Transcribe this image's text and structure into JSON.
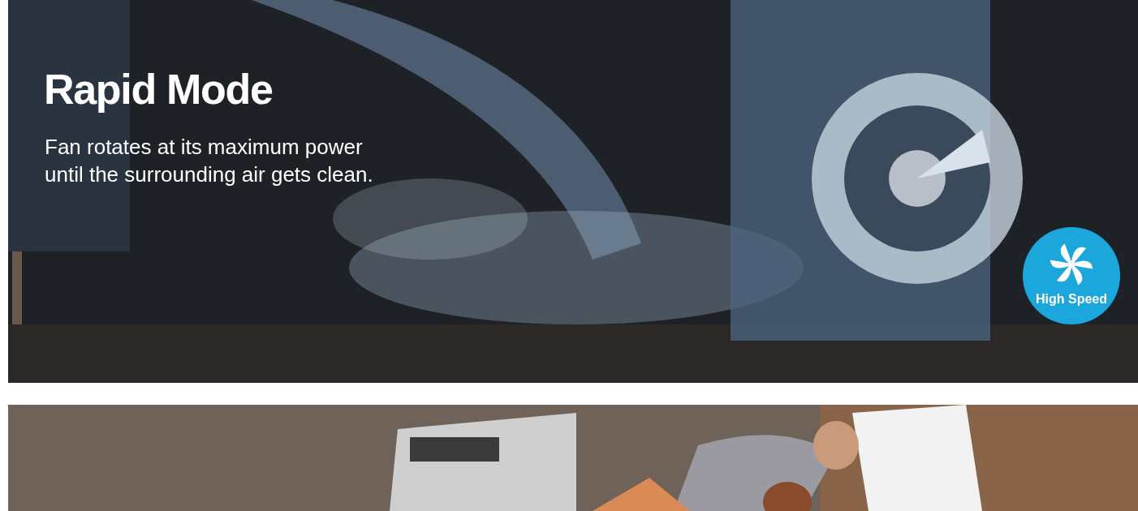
{
  "banners": [
    {
      "kind": "picture",
      "title": "Rapid Mode",
      "text": "Fan rotates at its maximum power until the surrounding air gets clean.",
      "badge": {
        "label": "High Speed"
      }
    },
    {
      "kind": "picture"
    }
  ]
}
